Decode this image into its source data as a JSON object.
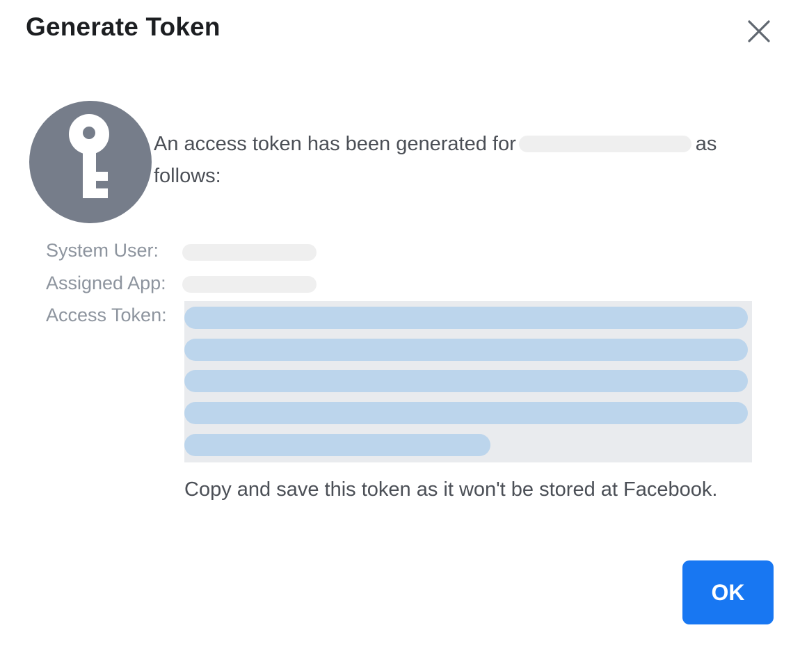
{
  "dialog": {
    "title": "Generate Token",
    "close_icon": "close-icon",
    "avatar_icon": "key-icon",
    "message_prefix": "An access token has been generated for",
    "message_suffix": "as follows:",
    "fields": {
      "system_user_label": "System User:",
      "assigned_app_label": "Assigned App:",
      "access_token_label": "Access Token:"
    },
    "note": "Copy and save this token as it won't be stored at Facebook.",
    "ok_label": "OK"
  },
  "colors": {
    "avatar_bg": "#767d8a",
    "token_box_bg": "#e9ebee",
    "redaction_light": "#efefef",
    "redaction_blue": "#bcd5ec",
    "primary_button": "#1877f2"
  }
}
